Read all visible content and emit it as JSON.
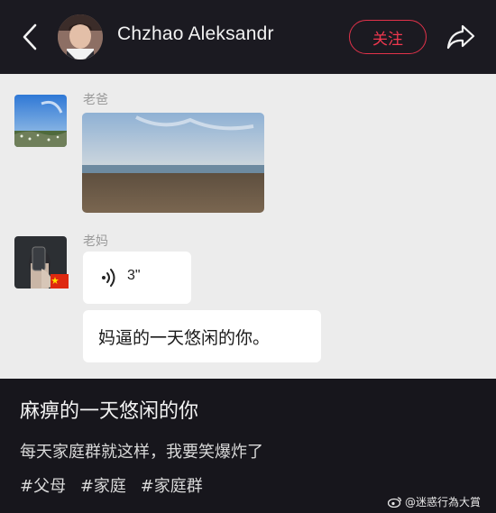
{
  "header": {
    "title": "Chzhao Aleksandr",
    "follow_label": "关注",
    "back_icon": "chevron-left-icon",
    "share_icon": "share-icon"
  },
  "chat": {
    "messages": [
      {
        "sender": "老爸",
        "type": "image"
      },
      {
        "sender": "老妈",
        "type": "voice",
        "duration": "3\""
      },
      {
        "type": "text",
        "text": "妈逼的一天悠闲的你。"
      }
    ]
  },
  "caption": {
    "title": "麻痹的一天悠闲的你",
    "body": "每天家庭群就这样，我要笑爆炸了",
    "tags": [
      "#父母",
      "#家庭",
      "#家庭群"
    ]
  },
  "watermark": "@迷惑行為大賞",
  "colors": {
    "accent": "#e2324a",
    "chat_bg": "#ececec",
    "dark_bg": "#17161c"
  }
}
